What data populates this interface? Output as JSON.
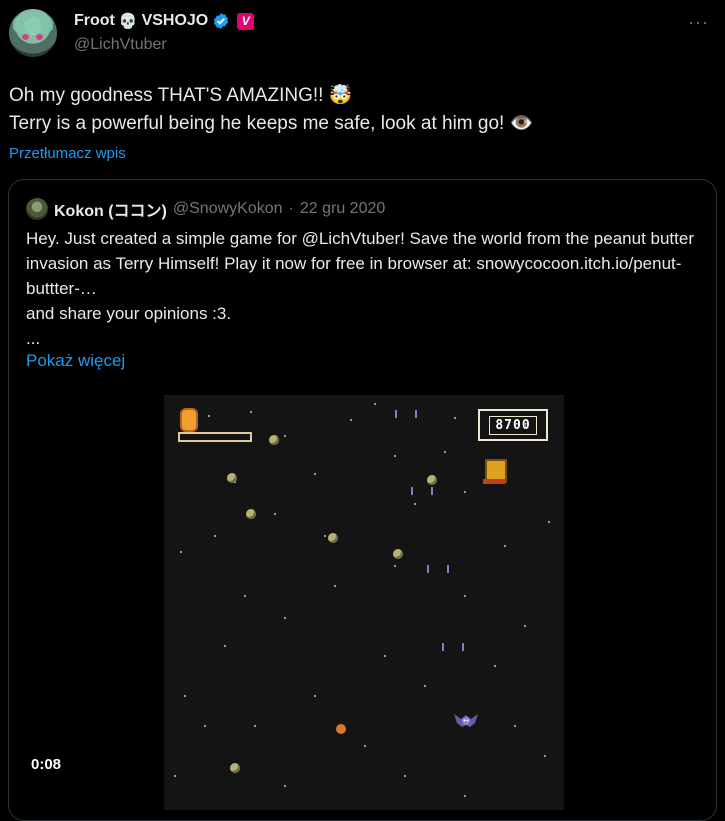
{
  "author": {
    "name": "Froot",
    "name_suffix": "VSHOJO",
    "skull_glyph": "💀",
    "handle": "@LichVtuber",
    "badge_letter": "V",
    "verified_icon": "verified-badge-icon",
    "brand_color": "#e0006f"
  },
  "tweet": {
    "text": "Oh my goodness THAT'S AMAZING!! 🤯\nTerry is a powerful being he keeps me safe, look at him go! 👁️",
    "translate_label": "Przetłumacz wpis"
  },
  "quote": {
    "name": "Kokon (ココン)",
    "handle": "@SnowyKokon",
    "separator": "·",
    "date": "22 gru 2020",
    "lines": [
      "Hey. Just created a simple game for @LichVtuber! Save the world from the peanut butter invasion as Terry Himself! Play it now for free in browser at: snowycocoon.itch.io/penut-buttter-…",
      "and share your opinions :3.",
      "..."
    ],
    "show_more": "Pokaż więcej"
  },
  "video": {
    "game_score": "8700",
    "duration": "0:08"
  },
  "colors": {
    "accent": "#1d9bf0",
    "muted": "#71767b",
    "text": "#e7e9ea"
  }
}
